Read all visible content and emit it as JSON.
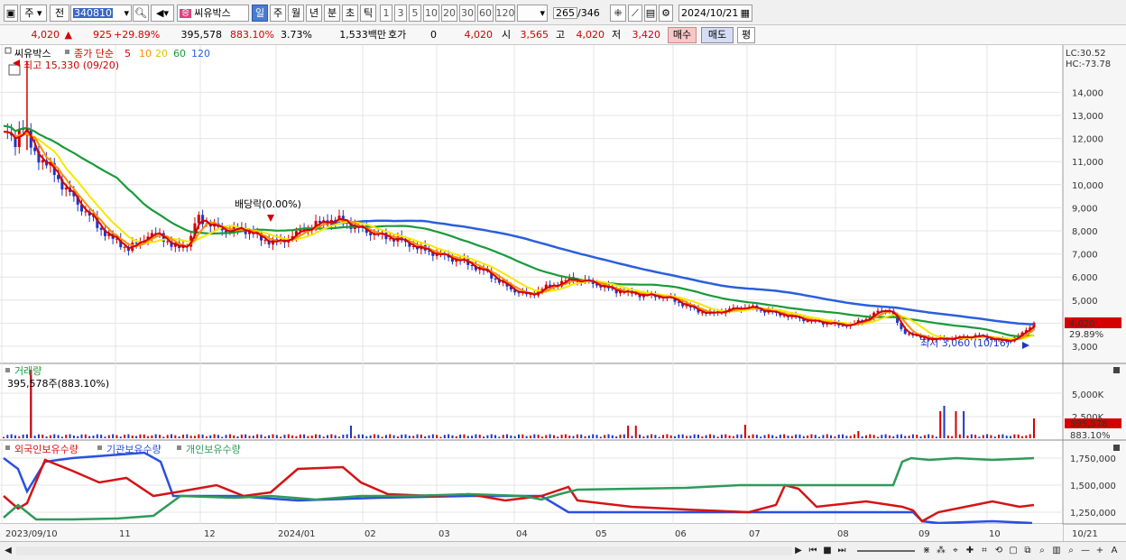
{
  "toolbar": {
    "period_type": "주",
    "market": "전",
    "code": "340810",
    "stock_badge": "증",
    "stock_name": "씨유박스",
    "period_tabs": [
      "일",
      "주",
      "월",
      "년",
      "분",
      "초",
      "틱"
    ],
    "active_period": "일",
    "interval_buttons": [
      "1",
      "3",
      "5",
      "10",
      "20",
      "30",
      "60",
      "120"
    ],
    "count": "265",
    "total": "/346",
    "date": "2024/10/21"
  },
  "info": {
    "price": "4,020",
    "change": "925",
    "change_pct": "+29.89%",
    "volume": "395,578",
    "volume_pct": "883.10%",
    "turnover": "3.73%",
    "amount": "1,533백만",
    "quote_label": "호가",
    "quote": "0",
    "quote_price": "4,020",
    "open_label": "시",
    "open": "3,565",
    "high_label": "고",
    "high": "4,020",
    "low_label": "저",
    "low": "3,420",
    "buy": "매수",
    "sell": "매도",
    "eval": "평"
  },
  "price_panel": {
    "stock_name": "씨유박스",
    "ma_prefix": "종가 단순",
    "ma_labels": [
      "5",
      "10",
      "20",
      "60",
      "120"
    ],
    "max_label": "최고 15,330 (09/20)",
    "min_label": "최저 3,060 (10/16)",
    "dividend_label": "배당락(0.00%)",
    "lc": "LC:30.52",
    "hc": "HC:-73.78",
    "current_price": "4,020",
    "current_pct": "29.89%",
    "y_ticks": [
      "14,000",
      "13,000",
      "12,000",
      "11,000",
      "10,000",
      "9,000",
      "8,000",
      "7,000",
      "6,000",
      "5,000",
      "4,000",
      "3,000"
    ]
  },
  "volume_panel": {
    "title": "거래량",
    "current": "395,578주(883.10%)",
    "y_ticks": [
      "5,000K",
      "2,500K"
    ],
    "current_value": "395,578",
    "current_pct": "883.10%"
  },
  "holdings_panel": {
    "legend": [
      "외국인보유수량",
      "기관보유수량",
      "개인보유수량"
    ],
    "y_ticks": [
      "1,750,000",
      "1,500,000",
      "1,250,000"
    ]
  },
  "x_axis": {
    "labels": [
      "2023/09/10",
      "11",
      "12",
      "2024/01",
      "02",
      "03",
      "04",
      "05",
      "06",
      "07",
      "08",
      "09",
      "10"
    ],
    "end_label": "10/21"
  },
  "colors": {
    "up": "#d40000",
    "down": "#1f35c8",
    "ma5": "#d40000",
    "ma10": "#ff8c00",
    "ma20": "#f5e800",
    "ma60": "#1a9a3a",
    "ma120": "#2a5fdc",
    "foreign": "#d41414",
    "institution": "#2a4fe0",
    "individual": "#2e9a5a"
  },
  "chart_data": {
    "type": "candlestick",
    "price_key_points": [
      {
        "month": "2023/09",
        "price": 12500
      },
      {
        "month": "2023/09",
        "high": 15330
      },
      {
        "month": "2023/10",
        "price": 9000
      },
      {
        "month": "2023/11",
        "price": 7300
      },
      {
        "month": "2023/12",
        "price": 8200
      },
      {
        "month": "2024/01",
        "price": 7800
      },
      {
        "month": "2024/02",
        "price": 8000
      },
      {
        "month": "2024/03",
        "price": 7000
      },
      {
        "month": "2024/04",
        "price": 5500
      },
      {
        "month": "2024/05",
        "price": 5700
      },
      {
        "month": "2024/06",
        "price": 5100
      },
      {
        "month": "2024/07",
        "price": 4500
      },
      {
        "month": "2024/08",
        "price": 3800
      },
      {
        "month": "2024/09",
        "price": 4200
      },
      {
        "month": "2024/10",
        "price": 3300
      },
      {
        "month": "2024/10/21",
        "price": 4020
      }
    ],
    "ylim": [
      2800,
      15200
    ]
  }
}
